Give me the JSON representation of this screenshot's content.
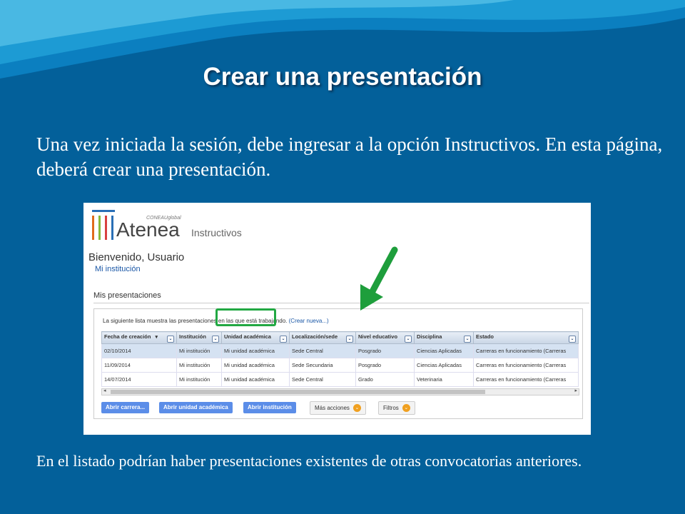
{
  "slide": {
    "title": "Crear una presentación",
    "body": "Una vez iniciada la sesión, debe ingresar a la opción Instructivos. En esta página, deberá crear una presentación.",
    "footer": "En el listado podrían haber presentaciones existentes de otras convocatorias anteriores."
  },
  "app": {
    "brand_small": "CONEAU",
    "brand_small_suffix": "global",
    "brand": "Atenea",
    "section": "Instructivos",
    "welcome": "Bienvenido, Usuario",
    "institution": "Mi institución",
    "list_title": "Mis presentaciones",
    "intro": "La siguiente lista muestra las presentaciones en las que está trabajando.",
    "create_link": "(Crear nueva...)"
  },
  "table": {
    "columns": [
      "Fecha de creación",
      "Institución",
      "Unidad académica",
      "Localización/sede",
      "Nivel educativo",
      "Disciplina",
      "Estado"
    ],
    "rows": [
      [
        "02/10/2014",
        "Mi institución",
        "Mi unidad académica",
        "Sede Central",
        "Posgrado",
        "Ciencias Aplicadas",
        "Carreras en funcionamiento (Carreras"
      ],
      [
        "11/09/2014",
        "Mi institución",
        "Mi unidad académica",
        "Sede Secundaria",
        "Posgrado",
        "Ciencias Aplicadas",
        "Carreras en funcionamiento (Carreras"
      ],
      [
        "14/07/2014",
        "Mi institución",
        "Mi unidad académica",
        "Sede Central",
        "Grado",
        "Veterinaria",
        "Carreras en funcionamiento (Carreras"
      ]
    ]
  },
  "buttons": {
    "open_career": "Abrir carrera...",
    "open_unit": "Abrir unidad académica",
    "open_institution": "Abrir institución",
    "more_actions": "Más acciones",
    "filters": "Filtros"
  },
  "colors": {
    "background": "#03609a",
    "highlight": "#22a843",
    "button": "#5b8de8"
  }
}
